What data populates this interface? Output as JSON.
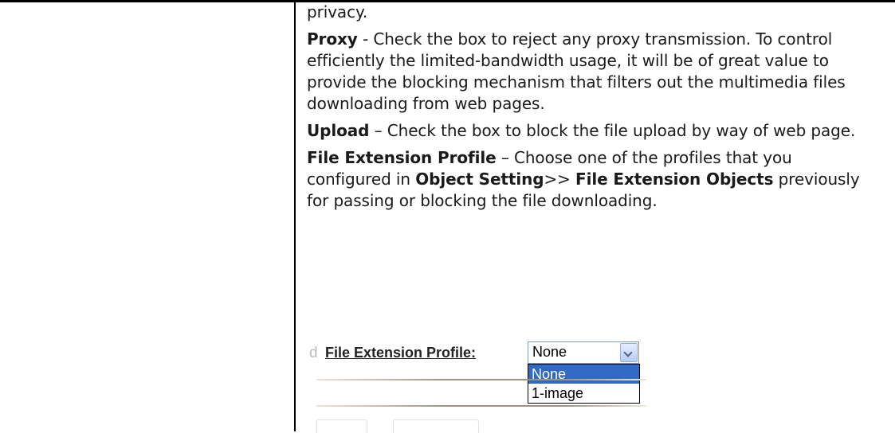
{
  "paragraphs": {
    "intro_tail": "privacy.",
    "proxy": {
      "term": "Proxy",
      "text": " - Check the box to reject any proxy transmission. To control efficiently the limited-bandwidth usage, it will be of great value to provide the blocking mechanism that filters out the multimedia files downloading from web pages."
    },
    "upload": {
      "term": "Upload",
      "text": " – Check the box to block the file upload by way of web page."
    },
    "profile": {
      "term": "File Extension Profile",
      "text_before": " – Choose one of the profiles that you configured in ",
      "ref_object": "Object Setting",
      "sep": ">> ",
      "ref_objects": "File Extension Objects",
      "text_after": " previously for passing or blocking the file downloading."
    }
  },
  "screenshot": {
    "cut_char": "d",
    "field_label": "File Extension Profile:",
    "select_value": "None",
    "options": [
      "None",
      "1-image"
    ],
    "selected_color": "#316ac5"
  }
}
